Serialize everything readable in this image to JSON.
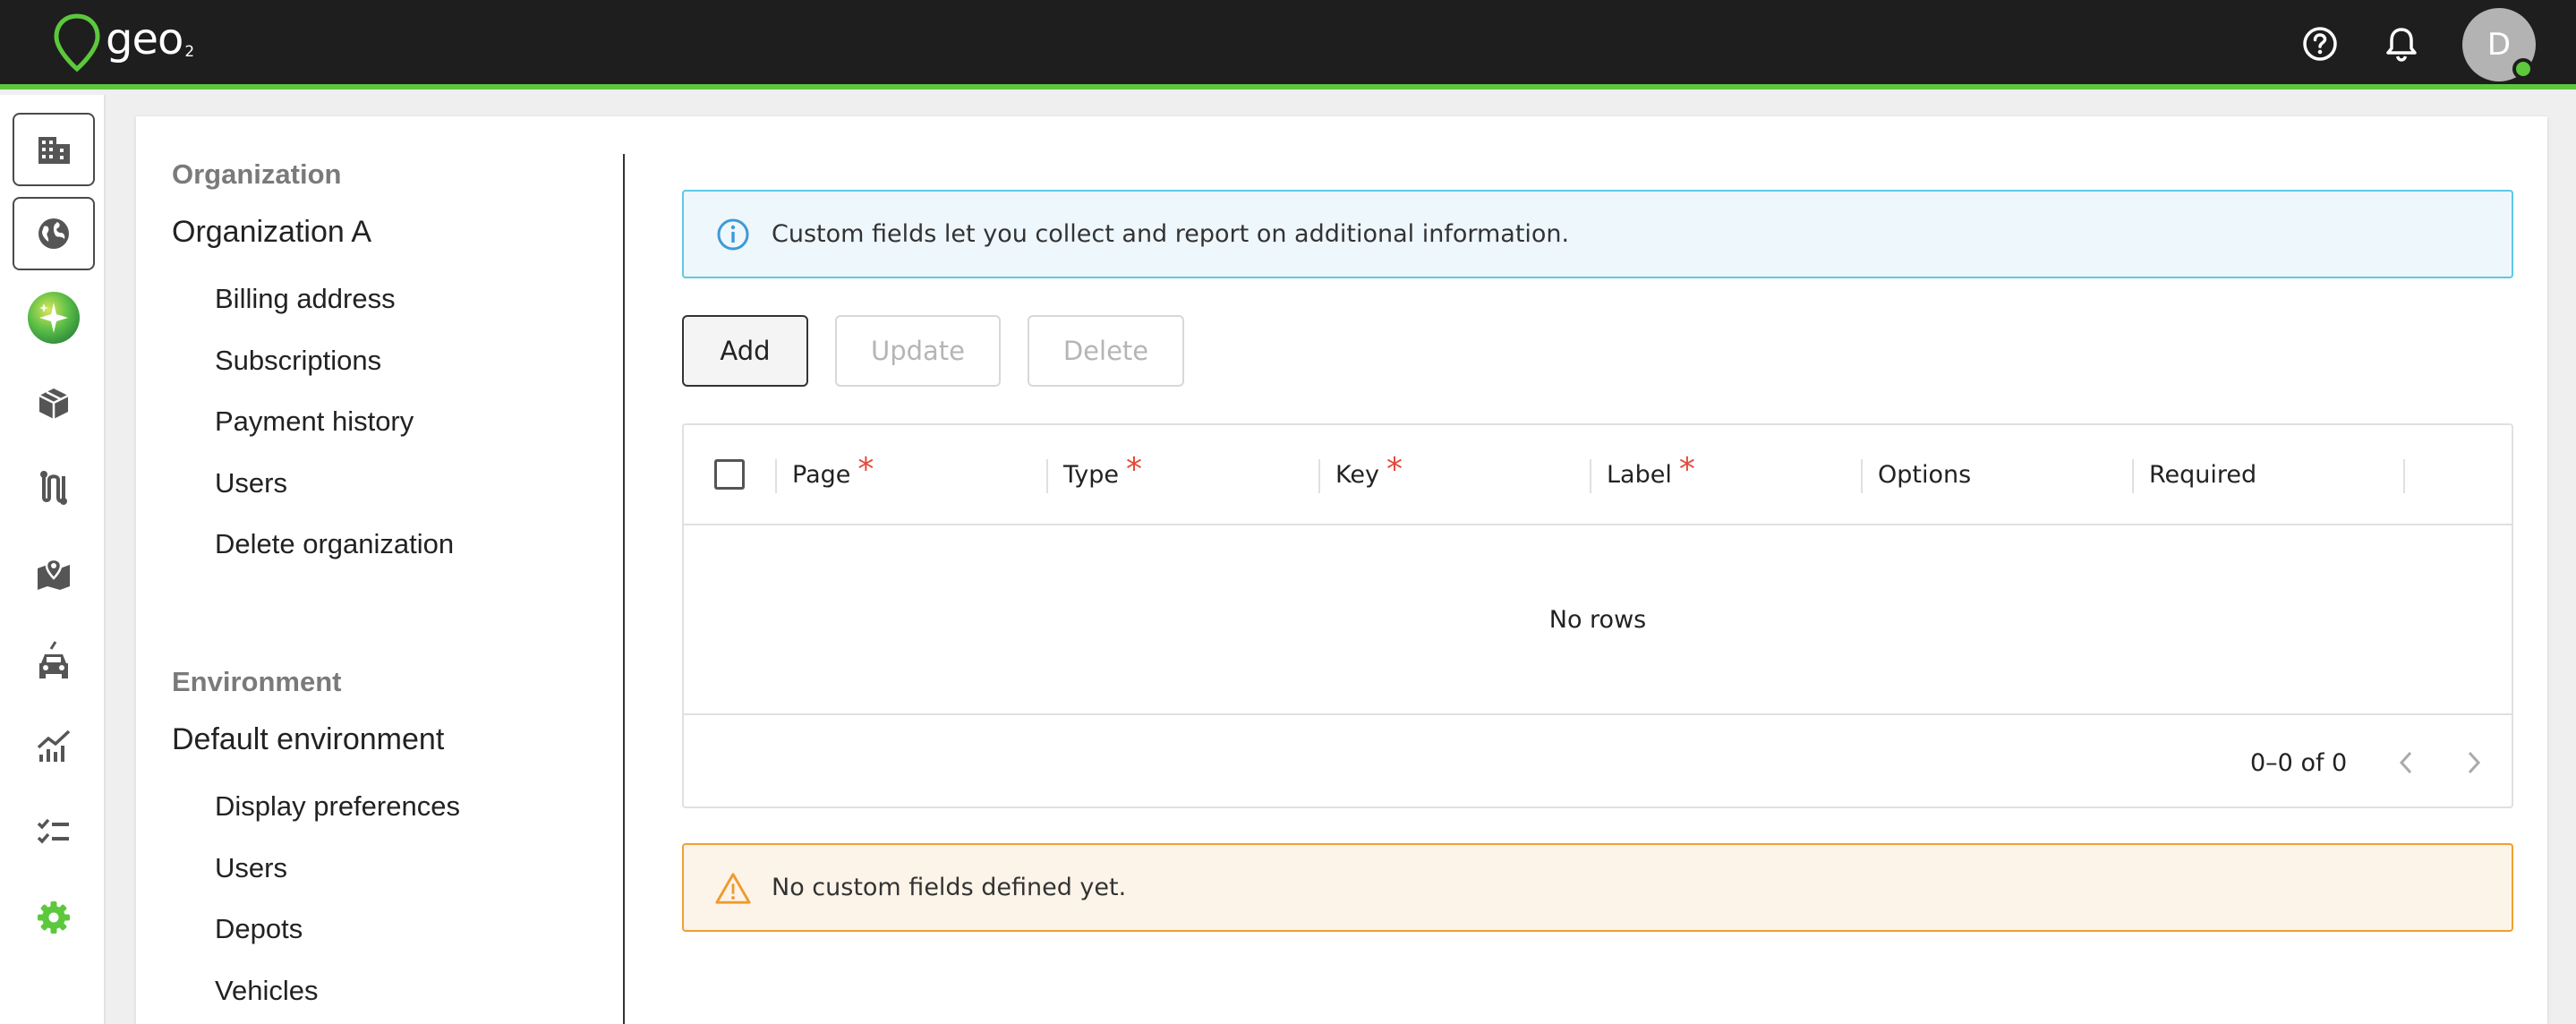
{
  "app": {
    "logo_text": "geo",
    "logo_sub": "2",
    "brand_color": "#5cc83c"
  },
  "topbar": {
    "help_icon": "help-circle-icon",
    "notifications_icon": "bell-icon",
    "avatar_initial": "D"
  },
  "rail": {
    "items": [
      {
        "icon": "building-icon",
        "selected": true
      },
      {
        "icon": "globe-icon",
        "selected": true
      },
      {
        "icon": "sparkle-orb-icon"
      },
      {
        "icon": "package-icon"
      },
      {
        "icon": "route-icon"
      },
      {
        "icon": "map-pin-icon"
      },
      {
        "icon": "vehicle-icon"
      },
      {
        "icon": "analytics-chart-icon"
      },
      {
        "icon": "checklist-icon"
      },
      {
        "icon": "settings-gear-icon",
        "active": true
      }
    ]
  },
  "nav": {
    "organization": {
      "heading": "Organization",
      "title": "Organization A",
      "items": [
        "Billing address",
        "Subscriptions",
        "Payment history",
        "Users",
        "Delete organization"
      ]
    },
    "environment": {
      "heading": "Environment",
      "title": "Default environment",
      "items": [
        "Display preferences",
        "Users",
        "Depots",
        "Vehicles"
      ]
    }
  },
  "main": {
    "info_message": "Custom fields let you collect and report on additional information.",
    "buttons": {
      "add": "Add",
      "update": "Update",
      "delete": "Delete"
    },
    "table": {
      "columns": [
        {
          "label": "Page",
          "required": true
        },
        {
          "label": "Type",
          "required": true
        },
        {
          "label": "Key",
          "required": true
        },
        {
          "label": "Label",
          "required": true
        },
        {
          "label": "Options",
          "required": false
        },
        {
          "label": "Required",
          "required": false
        }
      ],
      "required_marker": "*",
      "empty_text": "No rows",
      "pagination": "0–0 of 0"
    },
    "warning_message": "No custom fields defined yet."
  }
}
